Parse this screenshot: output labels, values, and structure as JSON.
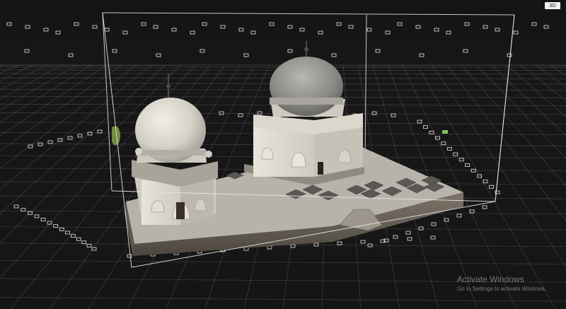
{
  "viewer": {
    "view_mode_button": "3D",
    "background_color": "#151515",
    "grid_color": "#8a8a8a",
    "bounding_box_color": "#e6e6e6",
    "camera_marker_icon": "camera-frustum-icon",
    "model_subject": "tomb monuments with domes on a stone platform"
  },
  "watermark": {
    "title": "Activate Windows",
    "subtitle": "Go to Settings to activate Windows."
  }
}
